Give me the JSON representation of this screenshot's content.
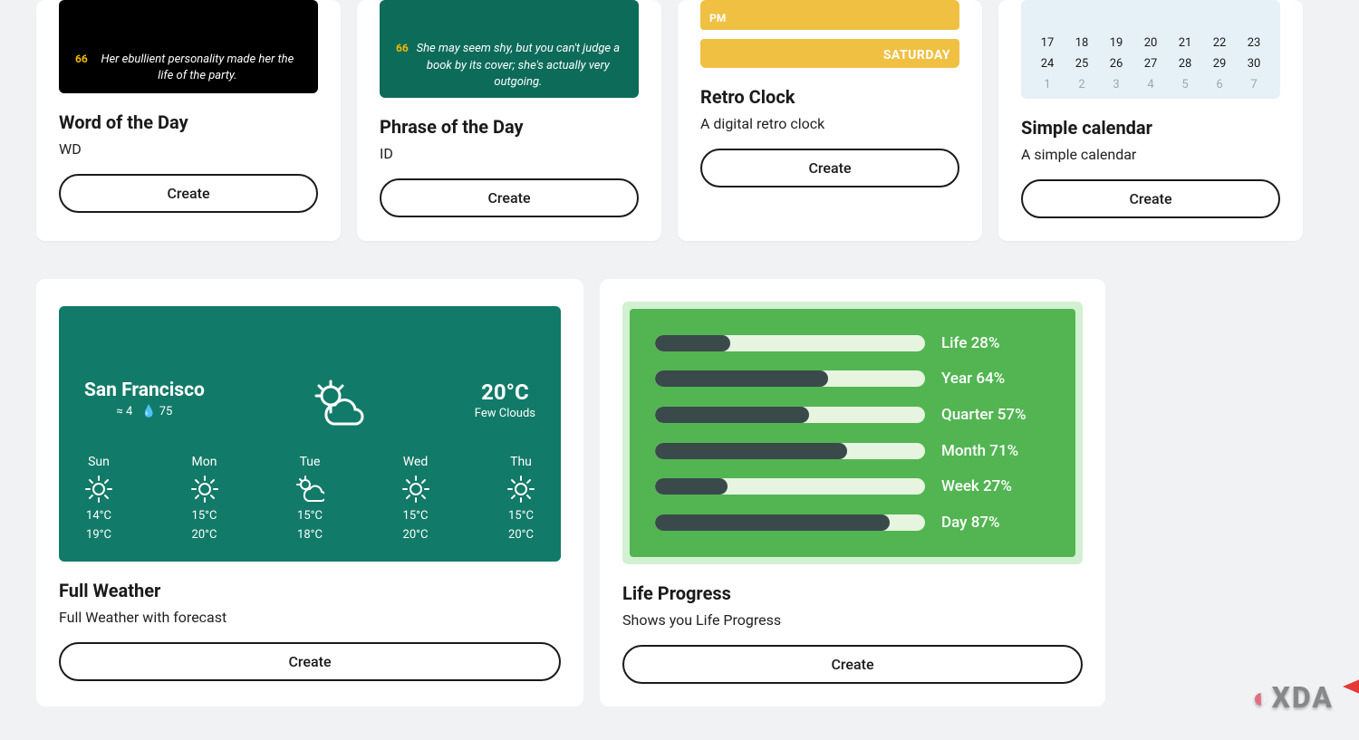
{
  "cards": {
    "wod": {
      "title": "Word of the Day",
      "desc": "WD",
      "quoteNum": "66",
      "quote": "Her ebullient personality made her the life of the party.",
      "btn": "Create"
    },
    "pod": {
      "title": "Phrase of the Day",
      "desc": "ID",
      "quoteNum": "66",
      "quote": "She may seem shy, but you can't judge a book by its cover; she's actually very outgoing.",
      "btn": "Create"
    },
    "retro": {
      "title": "Retro Clock",
      "desc": "A digital retro clock",
      "pm": "PM",
      "day": "SATURDAY",
      "btn": "Create"
    },
    "cal": {
      "title": "Simple calendar",
      "desc": "A simple calendar",
      "btn": "Create",
      "rows": [
        [
          "17",
          "18",
          "19",
          "20",
          "21",
          "22",
          "23"
        ],
        [
          "24",
          "25",
          "26",
          "27",
          "28",
          "29",
          "30"
        ],
        [
          "1",
          "2",
          "3",
          "4",
          "5",
          "6",
          "7"
        ]
      ]
    },
    "weather": {
      "title": "Full Weather",
      "desc": "Full Weather with forecast",
      "btn": "Create",
      "city": "San Francisco",
      "wind": "≈ 4",
      "hum": "💧 75",
      "temp": "20°C",
      "cond": "Few Clouds",
      "forecast": [
        {
          "d": "Sun",
          "lo": "14°C",
          "hi": "19°C",
          "icon": "sun"
        },
        {
          "d": "Mon",
          "lo": "15°C",
          "hi": "20°C",
          "icon": "sun"
        },
        {
          "d": "Tue",
          "lo": "15°C",
          "hi": "18°C",
          "icon": "cloud"
        },
        {
          "d": "Wed",
          "lo": "15°C",
          "hi": "20°C",
          "icon": "sun"
        },
        {
          "d": "Thu",
          "lo": "15°C",
          "hi": "20°C",
          "icon": "sun"
        }
      ]
    },
    "life": {
      "title": "Life Progress",
      "desc": "Shows you Life Progress",
      "btn": "Create",
      "bars": [
        {
          "label": "Life 28%",
          "v": 28
        },
        {
          "label": "Year 64%",
          "v": 64
        },
        {
          "label": "Quarter 57%",
          "v": 57
        },
        {
          "label": "Month 71%",
          "v": 71
        },
        {
          "label": "Week 27%",
          "v": 27
        },
        {
          "label": "Day 87%",
          "v": 87
        }
      ]
    }
  },
  "logo": "XDA"
}
